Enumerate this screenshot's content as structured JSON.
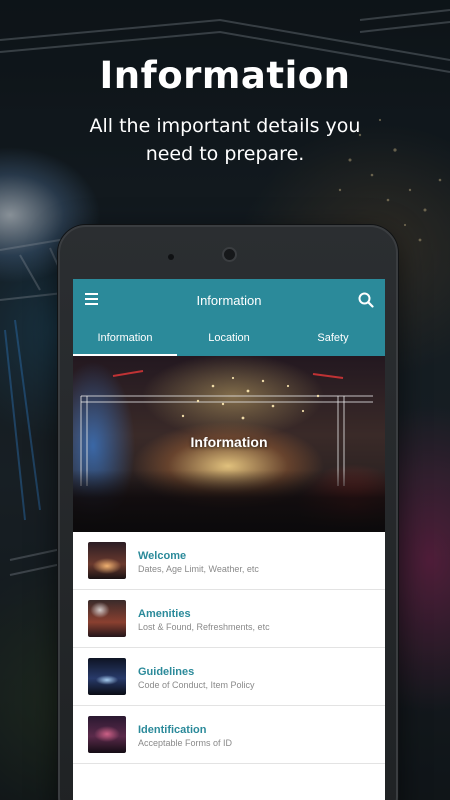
{
  "hero": {
    "title": "Information",
    "subtitle": "All the important details you need to prepare."
  },
  "appbar": {
    "title": "Information",
    "menu_icon": "hamburger-menu-icon",
    "search_icon": "search-icon"
  },
  "tabs": [
    {
      "label": "Information",
      "active": true
    },
    {
      "label": "Location",
      "active": false
    },
    {
      "label": "Safety",
      "active": false
    }
  ],
  "banner": {
    "title": "Information"
  },
  "list": [
    {
      "title": "Welcome",
      "subtitle": "Dates, Age Limit, Weather, etc"
    },
    {
      "title": "Amenities",
      "subtitle": "Lost & Found, Refreshments, etc"
    },
    {
      "title": "Guidelines",
      "subtitle": "Code of Conduct, Item Policy"
    },
    {
      "title": "Identification",
      "subtitle": "Acceptable Forms of ID"
    }
  ],
  "colors": {
    "accent": "#2b8a9a",
    "text_on_accent": "#ffffff",
    "subtitle_gray": "#8a8a8a"
  }
}
